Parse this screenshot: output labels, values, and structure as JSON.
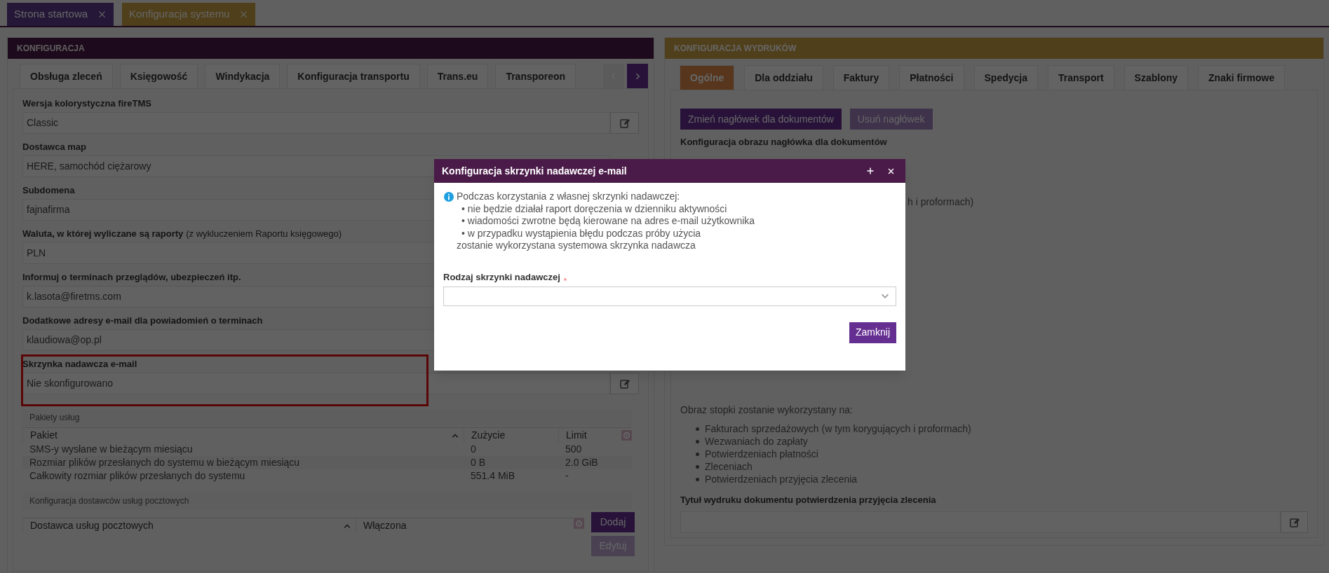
{
  "top_tabs": [
    {
      "label": "Strona startowa",
      "selected": false
    },
    {
      "label": "Konfiguracja systemu",
      "selected": true
    }
  ],
  "left_panel": {
    "title": "KONFIGURACJA",
    "tabs": [
      {
        "label": "Obsługa zleceń",
        "selected": false
      },
      {
        "label": "Księgowość",
        "selected": false
      },
      {
        "label": "Windykacja",
        "selected": false
      },
      {
        "label": "Konfiguracja transportu",
        "selected": false
      },
      {
        "label": "Trans.eu",
        "selected": false
      },
      {
        "label": "Transporeon",
        "selected": false
      }
    ],
    "tab_nav": [
      {
        "kind": "prev",
        "disabled": true
      },
      {
        "kind": "next",
        "disabled": false
      }
    ],
    "fields": [
      {
        "label": "Wersja kolorystyczna fireTMS",
        "value": "Classic",
        "editable": true,
        "highlighted": false
      },
      {
        "label": "Dostawca map",
        "value": "HERE, samochód ciężarowy",
        "editable": false,
        "highlighted": false
      },
      {
        "label": "Subdomena",
        "value": "fajnafirma",
        "editable": false,
        "highlighted": false
      },
      {
        "label": "Waluta, w której wyliczane są raporty",
        "note": "(z wykluczeniem Raportu księgowego)",
        "value": "PLN",
        "editable": false,
        "highlighted": false
      },
      {
        "label": "Informuj o terminach przeglądów, ubezpieczeń itp.",
        "value": "k.lasota@firetms.com",
        "editable": false,
        "highlighted": false
      },
      {
        "label": "Dodatkowe adresy e-mail dla powiadomień o terminach",
        "value": "klaudiowa@op.pl",
        "editable": false,
        "highlighted": false
      },
      {
        "label": "Skrzynka nadawcza e-mail",
        "value": "Nie skonfigurowano",
        "editable": true,
        "highlighted": true
      }
    ],
    "packages": {
      "title": "Pakiety usług",
      "columns": [
        "Pakiet",
        "Zużycie",
        "Limit"
      ],
      "rows": [
        [
          "SMS-y wysłane w bieżącym miesiącu",
          "0",
          "500"
        ],
        [
          "Rozmiar plików przesłanych do systemu w bieżącym miesiącu",
          "0 B",
          "2.0 GiB"
        ],
        [
          "Całkowity rozmiar plików przesłanych do systemu",
          "551.4 MiB",
          "-"
        ]
      ]
    },
    "postal": {
      "title": "Konfiguracja dostawców usług pocztowych",
      "columns": [
        "Dostawca usług pocztowych",
        "Włączona"
      ],
      "buttons": [
        {
          "label": "Dodaj",
          "disabled": false
        },
        {
          "label": "Edytuj",
          "disabled": true
        }
      ]
    }
  },
  "right_panel": {
    "title": "KONFIGURACJA WYDRUKÓW",
    "tabs": [
      {
        "label": "Ogólne",
        "selected": true
      },
      {
        "label": "Dla oddziału",
        "selected": false
      },
      {
        "label": "Faktury",
        "selected": false
      },
      {
        "label": "Płatności",
        "selected": false
      },
      {
        "label": "Spedycja",
        "selected": false
      },
      {
        "label": "Transport",
        "selected": false
      },
      {
        "label": "Szablony",
        "selected": false
      },
      {
        "label": "Znaki firmowe",
        "selected": false
      }
    ],
    "buttons": [
      {
        "label": "Zmień nagłówek dla dokumentów",
        "disabled": false
      },
      {
        "label": "Usuń nagłówek",
        "disabled": true
      }
    ],
    "header_label": "Konfiguracja obrazu nagłówka dla dokumentów",
    "partial_text": "h i proformach)",
    "footer_intro": "Obraz stopki zostanie wykorzystany na:",
    "footer_items": [
      "Fakturach sprzedażowych (w tym korygujących i proformach)",
      "Wezwaniach do zapłaty",
      "Potwierdzeniach płatności",
      "Zleceniach",
      "Potwierdzeniach przyjęcia zlecenia"
    ],
    "title_field": {
      "label": "Tytuł wydruku dokumentu potwierdzenia przyjęcia zlecenia",
      "editable": true
    }
  },
  "modal": {
    "title": "Konfiguracja skrzynki nadawczej e-mail",
    "info_lines": [
      "Podczas korzystania z własnej skrzynki nadawczej:",
      "• nie będzie działał raport doręczenia w dzienniku aktywności",
      "• wiadomości zwrotne będą kierowane na adres e-mail użytkownika",
      "• w przypadku wystąpienia błędu podczas próby użycia",
      "zostanie wykorzystana systemowa skrzynka nadawcza"
    ],
    "field": {
      "label": "Rodzaj skrzynki nadawczej",
      "required": true
    },
    "button": "Zamknij"
  }
}
